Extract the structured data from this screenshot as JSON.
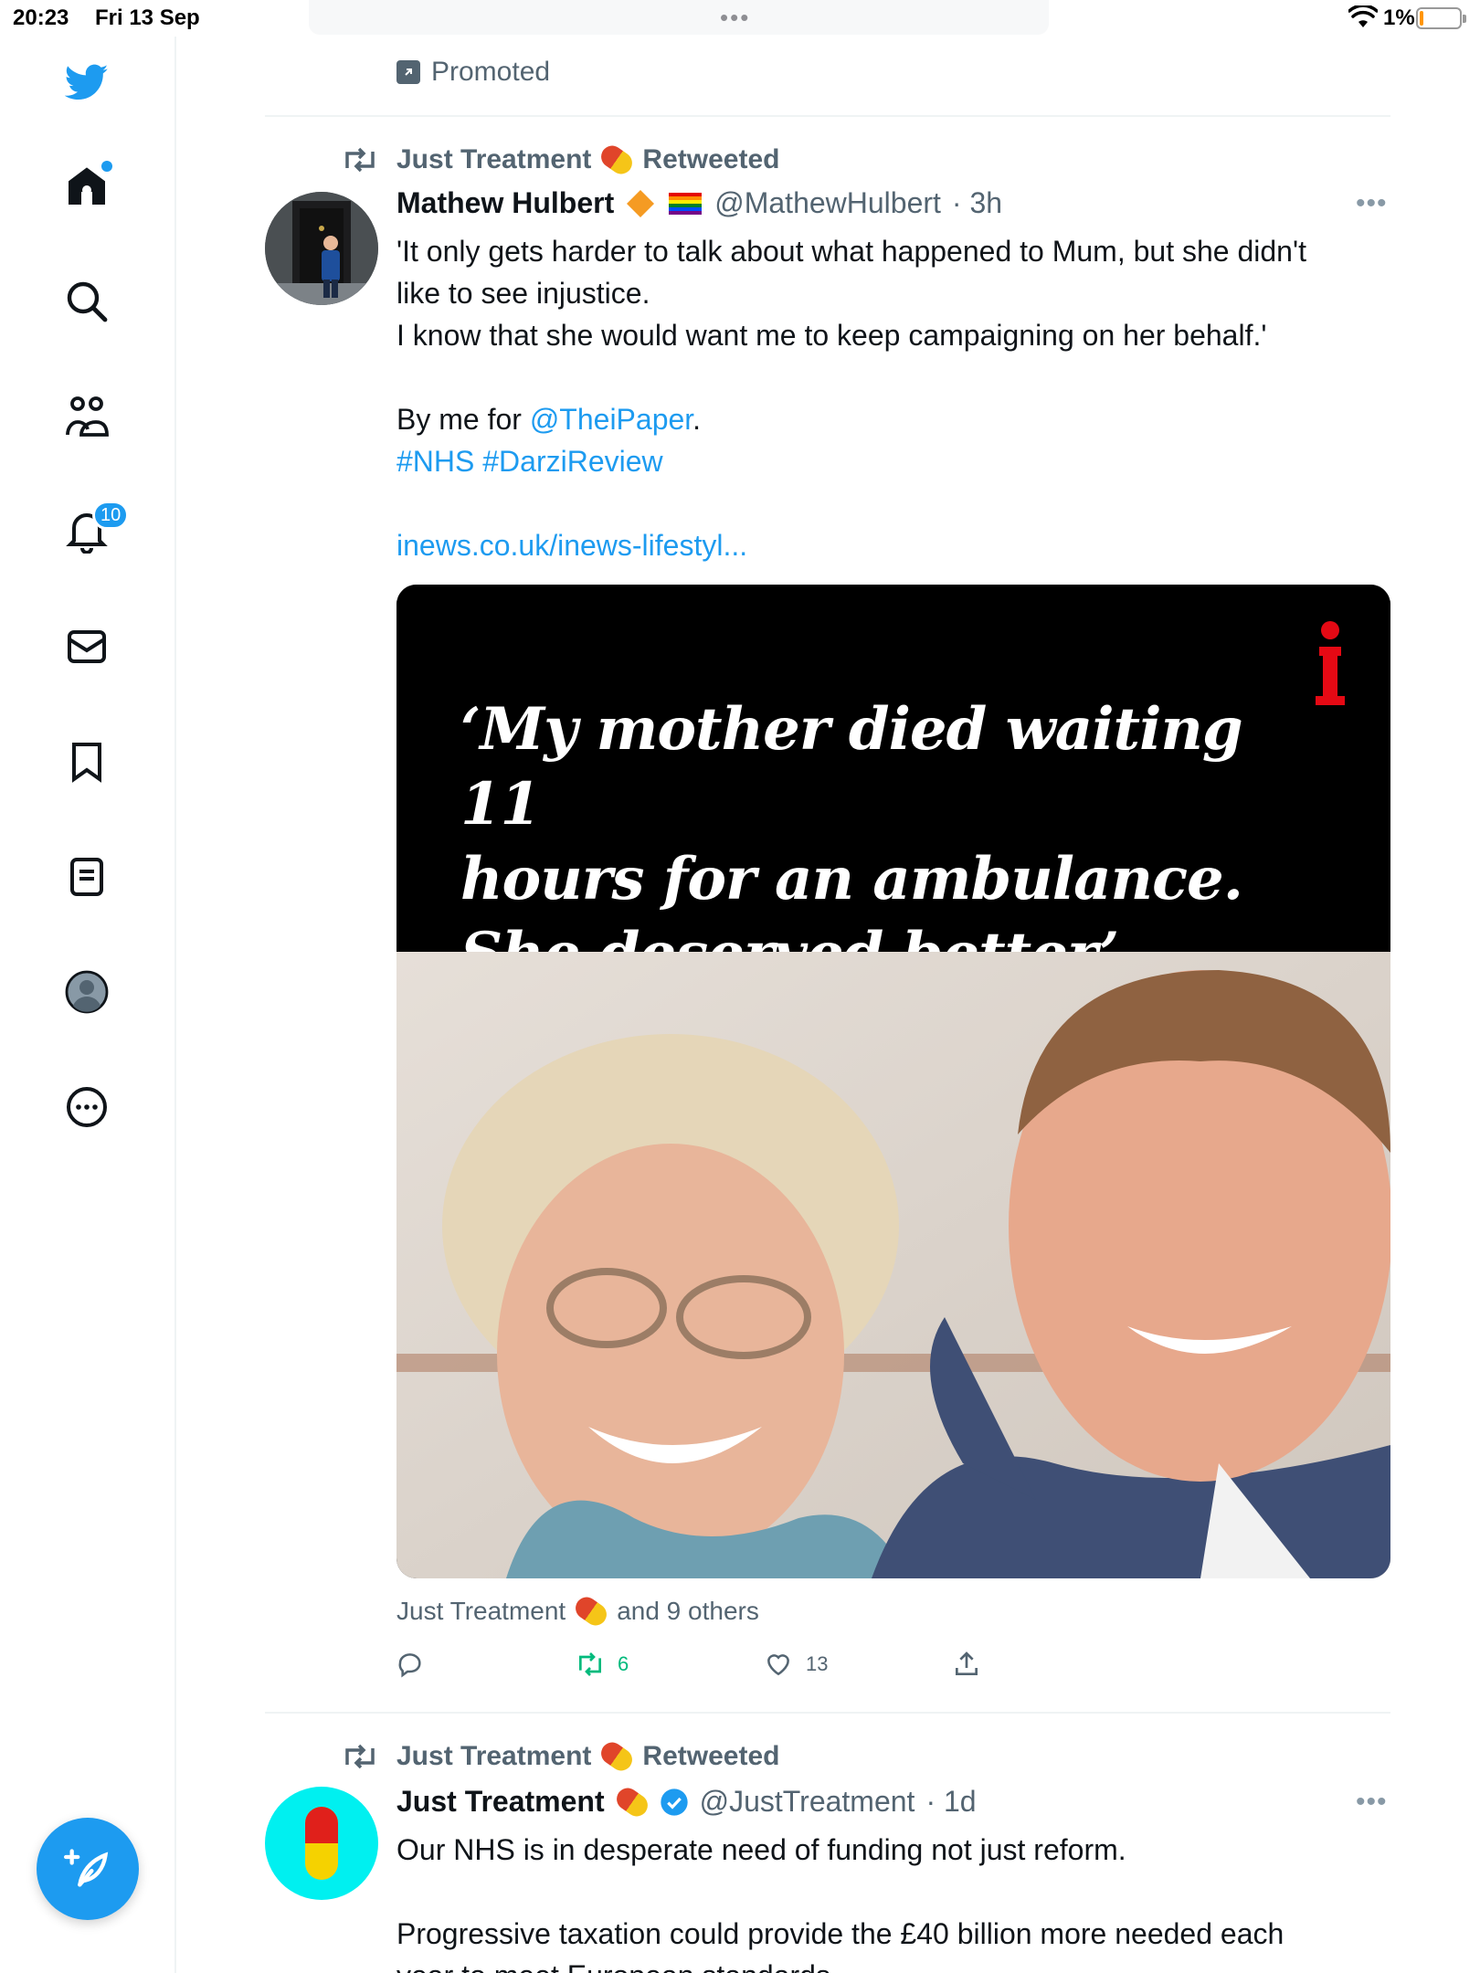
{
  "status_bar": {
    "time": "20:23",
    "date": "Fri 13 Sep",
    "battery_percent": "1%"
  },
  "sidebar": {
    "items": [
      {
        "icon": "twitter-bird-icon"
      },
      {
        "icon": "home-icon",
        "has_unread_dot": true
      },
      {
        "icon": "search-icon"
      },
      {
        "icon": "communities-icon"
      },
      {
        "icon": "notifications-bell-icon",
        "badge": "10"
      },
      {
        "icon": "messages-mail-icon"
      },
      {
        "icon": "bookmark-icon"
      },
      {
        "icon": "lists-icon"
      },
      {
        "icon": "profile-avatar-icon"
      },
      {
        "icon": "more-circle-icon"
      }
    ],
    "compose_icon": "compose-feather-icon"
  },
  "timeline": {
    "promoted_label": "Promoted",
    "tweet1": {
      "retweeted_by": "Just Treatment",
      "retweeted_label": "Retweeted",
      "author_name": "Mathew Hulbert",
      "handle": "@MathewHulbert",
      "time": "· 3h",
      "text_lines": [
        "'It only gets harder to talk about what happened to Mum, but she didn't",
        "like to see injustice.",
        "I know that she would want me to keep campaigning on her behalf.'"
      ],
      "by_prefix": "By me for ",
      "mention": "@TheiPaper",
      "by_suffix": ".",
      "hashtags": "#NHS #DarziReview",
      "link": "inews.co.uk/inews-lifestyl...",
      "card_headline_1": "‘My mother died waiting 11",
      "card_headline_2": "hours for an ambulance.",
      "card_headline_3": "She deserved better’",
      "social_context_name": "Just Treatment",
      "social_context_suffix": "and 9 others",
      "retweets": "6",
      "likes": "13"
    },
    "tweet2": {
      "retweeted_by": "Just Treatment",
      "retweeted_label": "Retweeted",
      "author_name": "Just Treatment",
      "handle": "@JustTreatment",
      "time": "· 1d",
      "text_line1": "Our NHS is in desperate need of funding not just reform.",
      "text_line2": "Progressive taxation could provide the £40 billion more needed each",
      "text_line3": "year to meet European standards."
    }
  },
  "colors": {
    "accent": "#1d9bf0",
    "retweet_green": "#00ba7c",
    "secondary_text": "#536471"
  }
}
